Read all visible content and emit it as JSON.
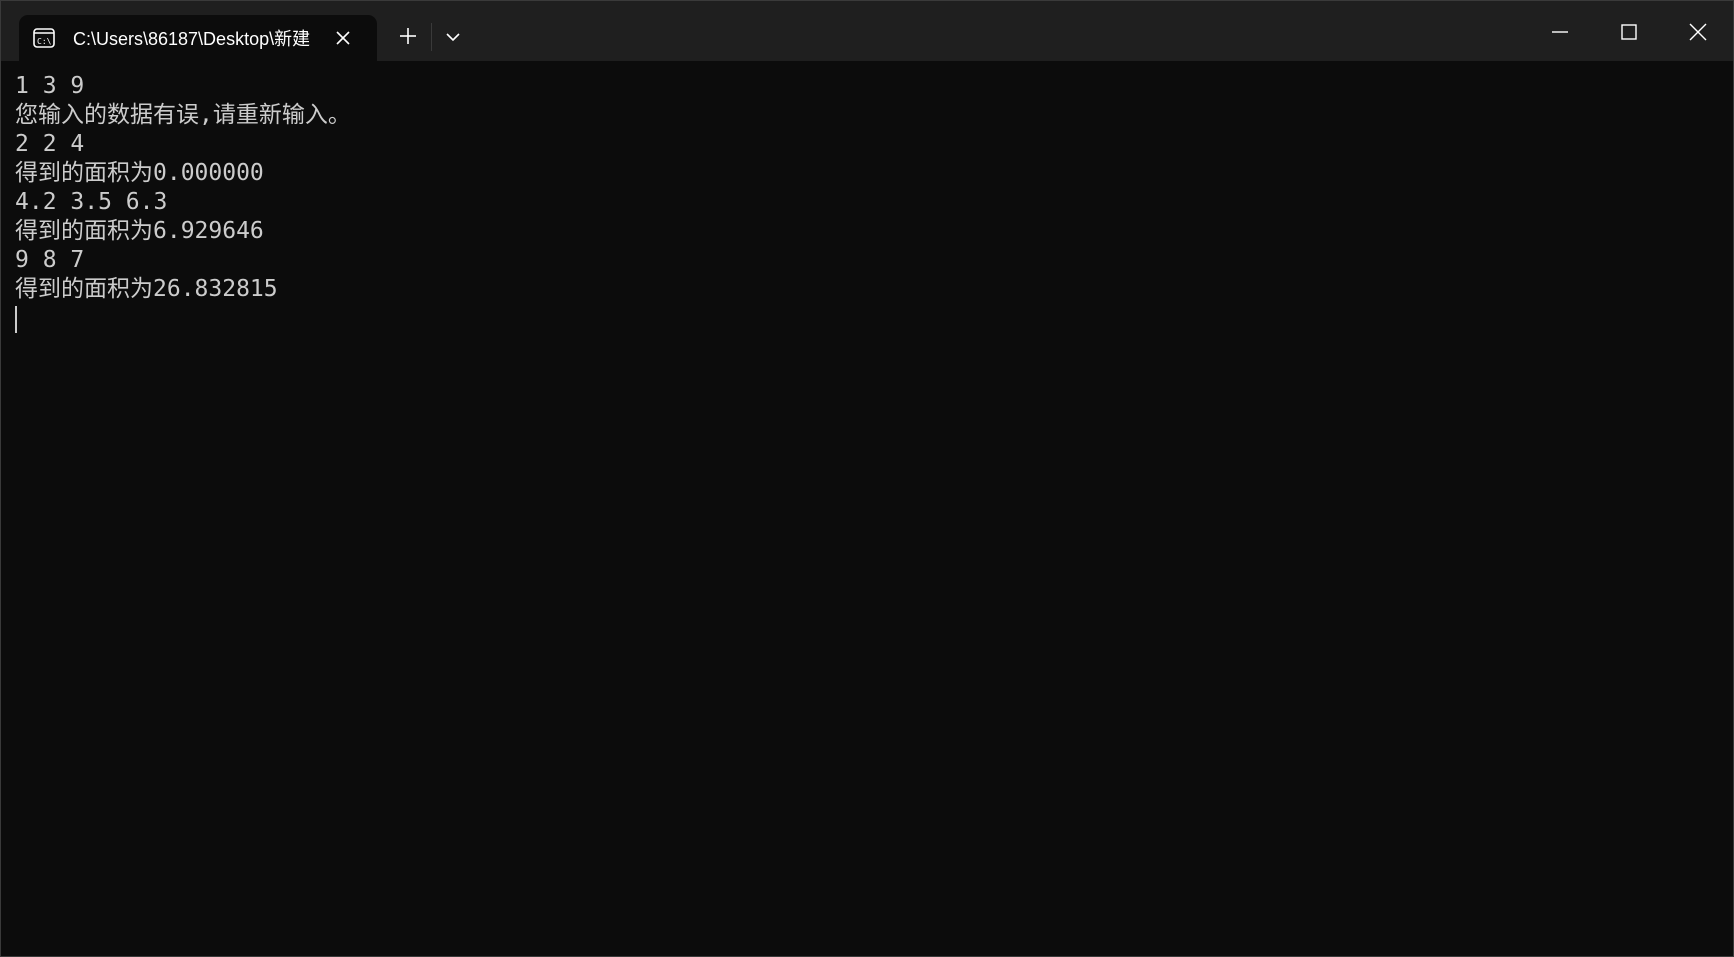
{
  "window": {
    "tab_title": "C:\\Users\\86187\\Desktop\\新建",
    "tab_icon": "terminal-icon",
    "new_tab_icon": "plus-icon",
    "dropdown_icon": "chevron-down-icon",
    "controls": [
      "minimize-icon",
      "maximize-icon",
      "close-icon"
    ]
  },
  "console": {
    "lines": [
      "1 3 9",
      "您输入的数据有误,请重新输入。",
      "2 2 4",
      "得到的面积为0.000000",
      "4.2 3.5 6.3",
      "得到的面积为6.929646",
      "9 8 7",
      "得到的面积为26.832815"
    ]
  },
  "colors": {
    "background": "#0c0c0c",
    "titlebar": "#1f1f1f",
    "text": "#cccccc"
  }
}
